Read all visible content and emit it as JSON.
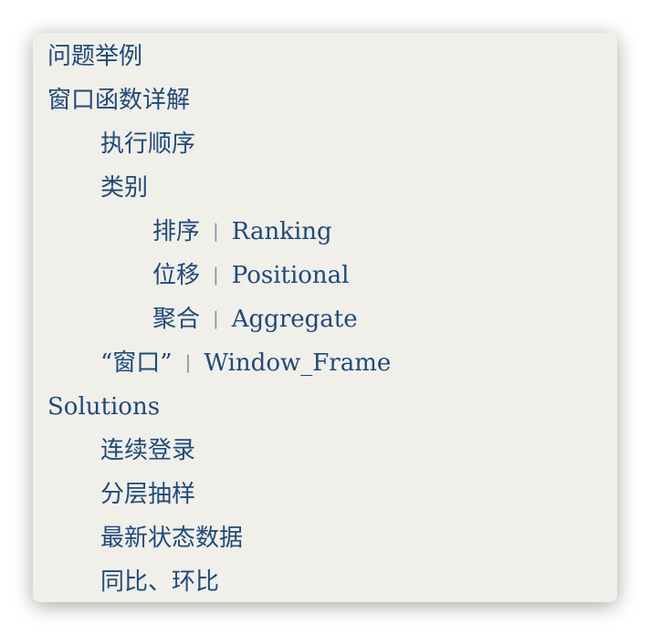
{
  "toc": {
    "items": [
      {
        "label": "问题举例"
      },
      {
        "label": "窗口函数详解"
      },
      {
        "label": "执行顺序"
      },
      {
        "label": "类别"
      },
      {
        "label": "排序",
        "separator": "|",
        "label_en": "Ranking"
      },
      {
        "label": "位移",
        "separator": "|",
        "label_en": "Positional"
      },
      {
        "label": "聚合",
        "separator": "|",
        "label_en": "Aggregate"
      },
      {
        "label": "“窗口”",
        "separator": "|",
        "label_en": "Window_Frame"
      },
      {
        "label": "Solutions"
      },
      {
        "label": "连续登录"
      },
      {
        "label": "分层抽样"
      },
      {
        "label": "最新状态数据"
      },
      {
        "label": "同比、环比"
      }
    ]
  },
  "colors": {
    "panel_background": "#f1efea",
    "link_text": "#1f4a79",
    "separator": "#7a8ea6"
  }
}
